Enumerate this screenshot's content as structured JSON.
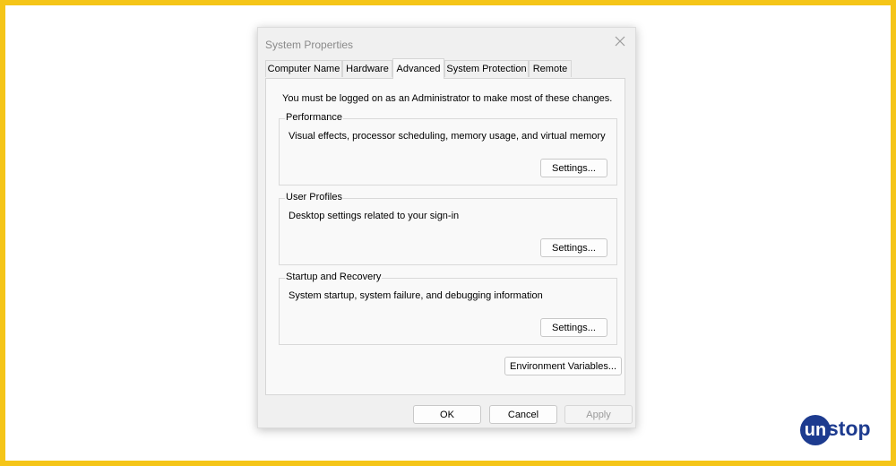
{
  "window": {
    "title": "System Properties",
    "close_icon": "close-icon"
  },
  "tabs": [
    {
      "label": "Computer Name",
      "active": false
    },
    {
      "label": "Hardware",
      "active": false
    },
    {
      "label": "Advanced",
      "active": true
    },
    {
      "label": "System Protection",
      "active": false
    },
    {
      "label": "Remote",
      "active": false
    }
  ],
  "notice": "You must be logged on as an Administrator to make most of these changes.",
  "groups": [
    {
      "label": "Performance",
      "description": "Visual effects, processor scheduling, memory usage, and virtual memory",
      "button": "Settings..."
    },
    {
      "label": "User Profiles",
      "description": "Desktop settings related to your sign-in",
      "button": "Settings..."
    },
    {
      "label": "Startup and Recovery",
      "description": "System startup, system failure, and debugging information",
      "button": "Settings..."
    }
  ],
  "environment_button": "Environment Variables...",
  "footer": {
    "ok": "OK",
    "cancel": "Cancel",
    "apply": "Apply"
  },
  "watermark": {
    "logo_letter": "un",
    "brand": "stop",
    "color": "#1d3b8f"
  }
}
